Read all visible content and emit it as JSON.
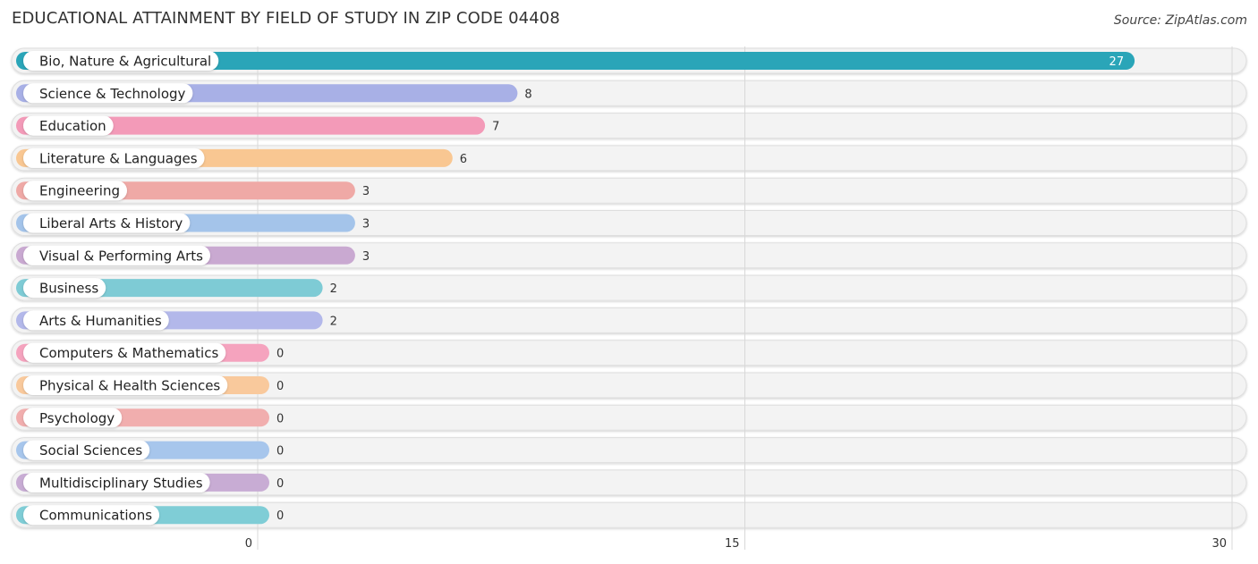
{
  "chart_data": {
    "type": "bar",
    "orientation": "horizontal",
    "title": "EDUCATIONAL ATTAINMENT BY FIELD OF STUDY IN ZIP CODE 04408",
    "source": "Source: ZipAtlas.com",
    "xlabel": "",
    "ylabel": "",
    "xlim": [
      0,
      30
    ],
    "xticks": [
      0,
      15,
      30
    ],
    "grid": true,
    "categories": [
      "Bio, Nature & Agricultural",
      "Science & Technology",
      "Education",
      "Literature & Languages",
      "Engineering",
      "Liberal Arts & History",
      "Visual & Performing Arts",
      "Business",
      "Arts & Humanities",
      "Computers & Mathematics",
      "Physical & Health Sciences",
      "Psychology",
      "Social Sciences",
      "Multidisciplinary Studies",
      "Communications"
    ],
    "values": [
      27,
      8,
      7,
      6,
      3,
      3,
      3,
      2,
      2,
      0,
      0,
      0,
      0,
      0,
      0
    ],
    "colors": [
      "#2aa5b8",
      "#a8b0e6",
      "#f39ab8",
      "#f9c792",
      "#efa9a6",
      "#a4c4ea",
      "#c9a9d1",
      "#7ecbd5",
      "#b3b8ea",
      "#f5a3be",
      "#f9c99c",
      "#f1aeae",
      "#a7c6ec",
      "#c8acd4",
      "#7fcdd6"
    ]
  }
}
